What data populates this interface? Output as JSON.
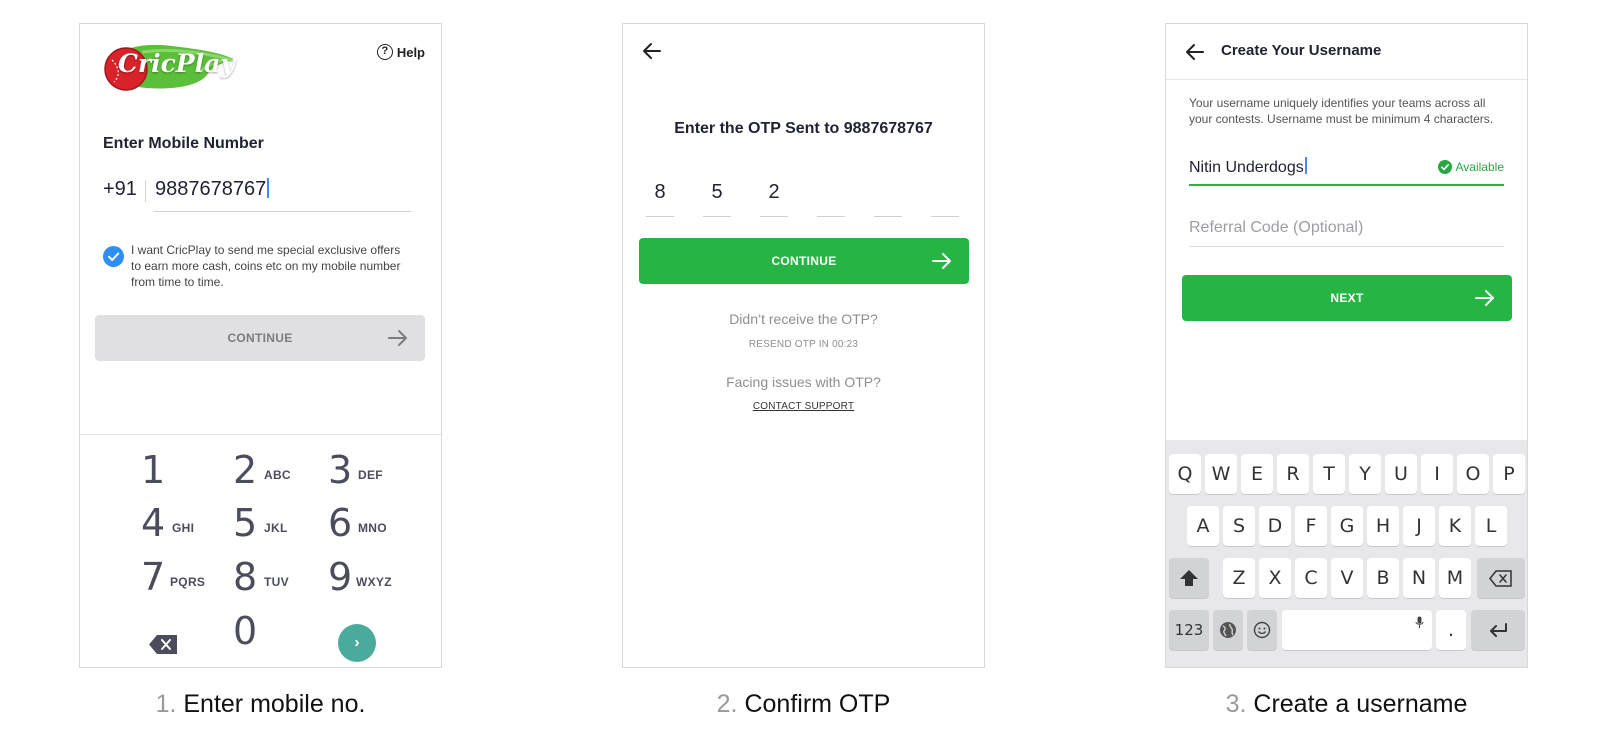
{
  "screens": [
    {
      "caption_number": "1.",
      "caption_text": "Enter mobile no.",
      "logo_text": "CricPlay",
      "help_label": "Help",
      "help_icon_glyph": "?",
      "title": "Enter Mobile Number",
      "country_code": "+91",
      "phone_value": "9887678767",
      "consent_text": "I want CricPlay to send me special exclusive offers to earn more cash, coins etc on my mobile number from time to time.",
      "consent_checked": true,
      "continue_label": "CONTINUE",
      "keypad": [
        {
          "digit": "1",
          "letters": ""
        },
        {
          "digit": "2",
          "letters": "ABC"
        },
        {
          "digit": "3",
          "letters": "DEF"
        },
        {
          "digit": "4",
          "letters": "GHI"
        },
        {
          "digit": "5",
          "letters": "JKL"
        },
        {
          "digit": "6",
          "letters": "MNO"
        },
        {
          "digit": "7",
          "letters": "PQRS"
        },
        {
          "digit": "8",
          "letters": "TUV"
        },
        {
          "digit": "9",
          "letters": "WXYZ"
        },
        {
          "digit": "0",
          "letters": ""
        }
      ],
      "go_glyph": "›"
    },
    {
      "caption_number": "2.",
      "caption_text": "Confirm OTP",
      "title": "Enter the OTP Sent to 9887678767",
      "otp_digits": [
        "8",
        "5",
        "2",
        "",
        "",
        ""
      ],
      "continue_label": "CONTINUE",
      "not_received": "Didn’t receive the OTP?",
      "resend": "RESEND OTP IN 00:23",
      "facing_issues": "Facing issues with OTP?",
      "contact_support": "CONTACT SUPPORT"
    },
    {
      "caption_number": "3.",
      "caption_text": "Create a username",
      "title": "Create Your Username",
      "description": "Your username uniquely identifies your teams across all your contests. Username must be minimum 4 characters.",
      "username_value": "Nitin Underdogs",
      "availability": "Available",
      "referral_placeholder": "Referral Code (Optional)",
      "next_label": "NEXT",
      "keyboard": {
        "row1": [
          "Q",
          "W",
          "E",
          "R",
          "T",
          "Y",
          "U",
          "I",
          "O",
          "P"
        ],
        "row2": [
          "A",
          "S",
          "D",
          "F",
          "G",
          "H",
          "J",
          "K",
          "L"
        ],
        "row3": [
          "Z",
          "X",
          "C",
          "V",
          "B",
          "N",
          "M"
        ],
        "numbers_key": "123",
        "period_key": "."
      }
    }
  ],
  "colors": {
    "primary_green": "#26b544",
    "checkbox_blue": "#2e8ef2",
    "keypad_go_teal": "#4aab9c",
    "disabled_button": "#e0e0e3",
    "available_green": "#28a745"
  },
  "icons": [
    "help-icon",
    "back-arrow-icon",
    "arrow-right-icon",
    "checkmark-icon",
    "backspace-icon",
    "shift-icon",
    "globe-icon",
    "emoji-icon",
    "mic-icon",
    "return-icon"
  ]
}
